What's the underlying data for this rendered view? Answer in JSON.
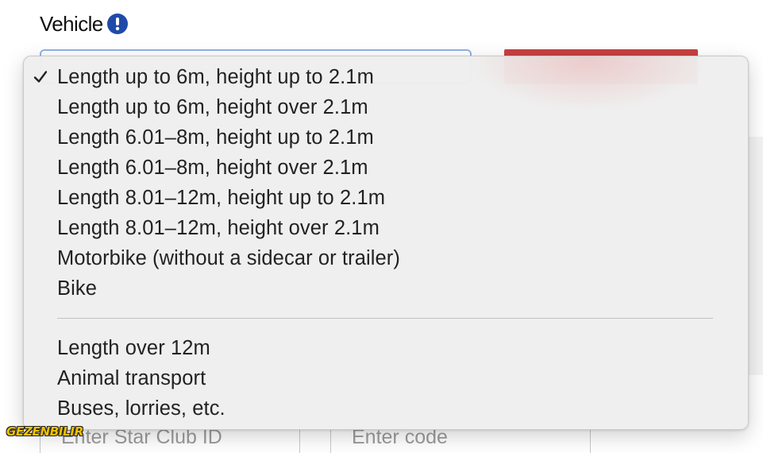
{
  "form": {
    "vehicle_label": "Vehicle",
    "info_icon": "exclamation-circle-icon",
    "star_club_placeholder": "Enter Star Club ID",
    "code_placeholder": "Enter code"
  },
  "menu": {
    "selected_index": 0,
    "check_icon": "checkmark-icon",
    "group1": [
      "Length up to 6m, height up to 2.1m",
      "Length up to 6m, height over 2.1m",
      "Length 6.01–8m, height up to 2.1m",
      "Length 6.01–8m, height over 2.1m",
      "Length 8.01–12m, height up to 2.1m",
      "Length 8.01–12m, height over 2.1m",
      "Motorbike (without a sidecar or trailer)",
      "Bike"
    ],
    "group2": [
      "Length over 12m",
      "Animal transport",
      "Buses, lorries, etc."
    ]
  },
  "watermark": "GEZENBILIR",
  "colors": {
    "primary_button": "#c94040",
    "info_icon": "#1f4aa8",
    "select_focus_border": "#8fb3e8",
    "menu_background": "#eeeeee"
  }
}
